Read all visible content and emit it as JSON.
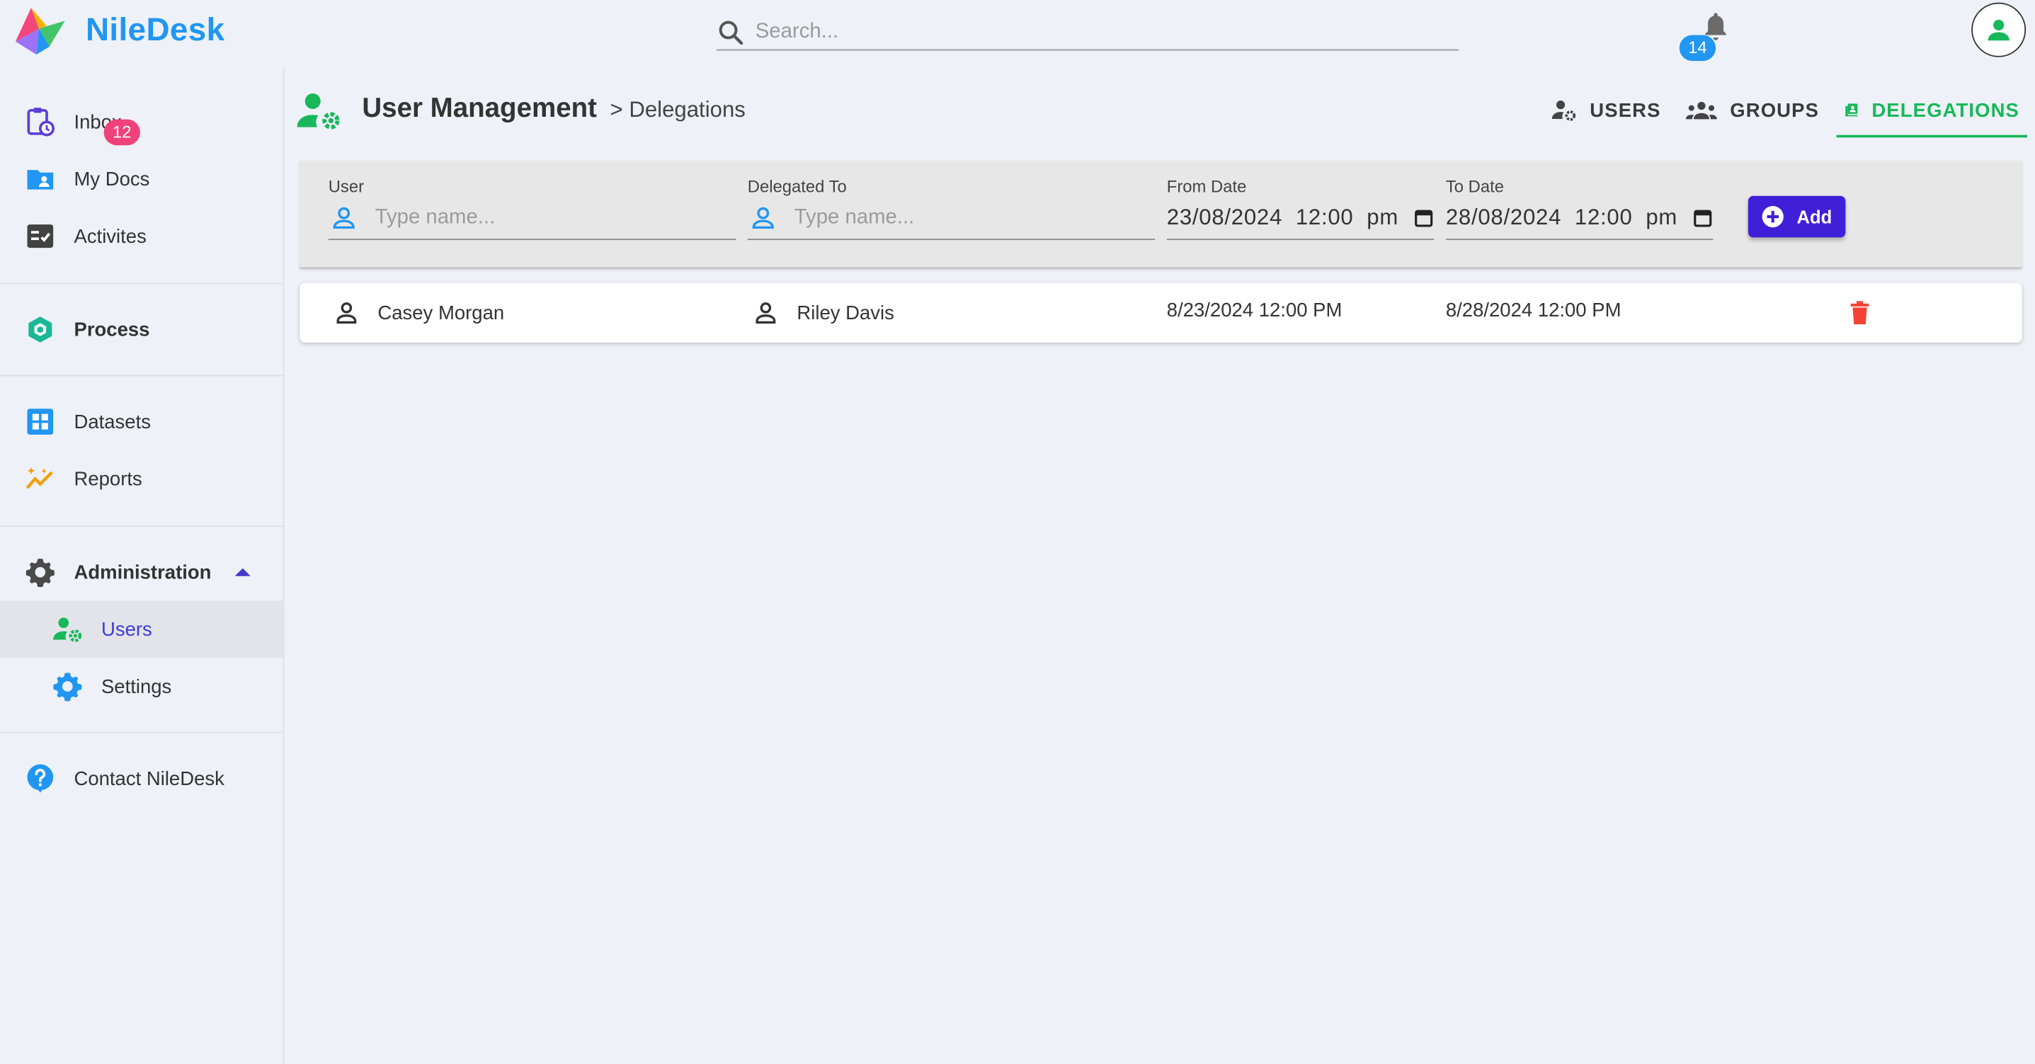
{
  "app": {
    "name": "NileDesk"
  },
  "header": {
    "search_placeholder": "Search...",
    "notification_count": "14"
  },
  "sidebar": {
    "inbox": {
      "label": "Inbox",
      "badge": "12"
    },
    "my_docs": "My Docs",
    "activities": "Activites",
    "process": "Process",
    "datasets": "Datasets",
    "reports": "Reports",
    "administration": "Administration",
    "users": "Users",
    "settings": "Settings",
    "contact": "Contact NileDesk"
  },
  "page": {
    "title": "User Management",
    "breadcrumb": "> Delegations",
    "tabs": {
      "users": "USERS",
      "groups": "GROUPS",
      "delegations": "DELEGATIONS"
    }
  },
  "filter": {
    "user_label": "User",
    "user_placeholder": "Type name...",
    "delegated_label": "Delegated To",
    "delegated_placeholder": "Type name...",
    "from_label": "From Date",
    "from_value": "23/08/2024  12:00  pm",
    "to_label": "To Date",
    "to_value": "28/08/2024  12:00  pm",
    "add_label": "Add"
  },
  "delegations": [
    {
      "user": "Casey Morgan",
      "delegated_to": "Riley Davis",
      "from": "8/23/2024 12:00 PM",
      "to": "8/28/2024 12:00 PM"
    }
  ],
  "colors": {
    "brand": "#2196f3",
    "accent_green": "#18b85a",
    "primary": "#3f1fd8",
    "danger": "#f44336",
    "inbox_badge": "#f0427a"
  }
}
